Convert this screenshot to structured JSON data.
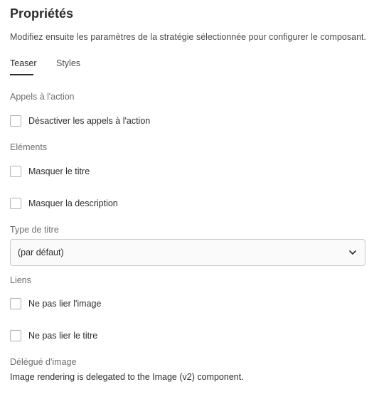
{
  "panel": {
    "title": "Propriétés",
    "description": "Modifiez ensuite les paramètres de la stratégie sélectionnée pour configurer le composant."
  },
  "tabs": [
    {
      "label": "Teaser",
      "active": true
    },
    {
      "label": "Styles",
      "active": false
    }
  ],
  "call_to_action": {
    "section_label": "Appels à l'action",
    "disable_cta": {
      "label": "Désactiver les appels à l'action",
      "checked": false
    }
  },
  "elements": {
    "section_label": "Eléments",
    "hide_title": {
      "label": "Masquer le titre",
      "checked": false
    },
    "hide_description": {
      "label": "Masquer la description",
      "checked": false
    }
  },
  "title_type": {
    "section_label": "Type de titre",
    "selected": "(par défaut)",
    "chevron_icon": "chevron-down-icon"
  },
  "links": {
    "section_label": "Liens",
    "no_image_link": {
      "label": "Ne pas lier l'image",
      "checked": false
    },
    "no_title_link": {
      "label": "Ne pas lier le titre",
      "checked": false
    }
  },
  "image_delegate": {
    "section_label": "Délégué d'image",
    "text": "Image rendering is delegated to the Image (v2) component."
  }
}
